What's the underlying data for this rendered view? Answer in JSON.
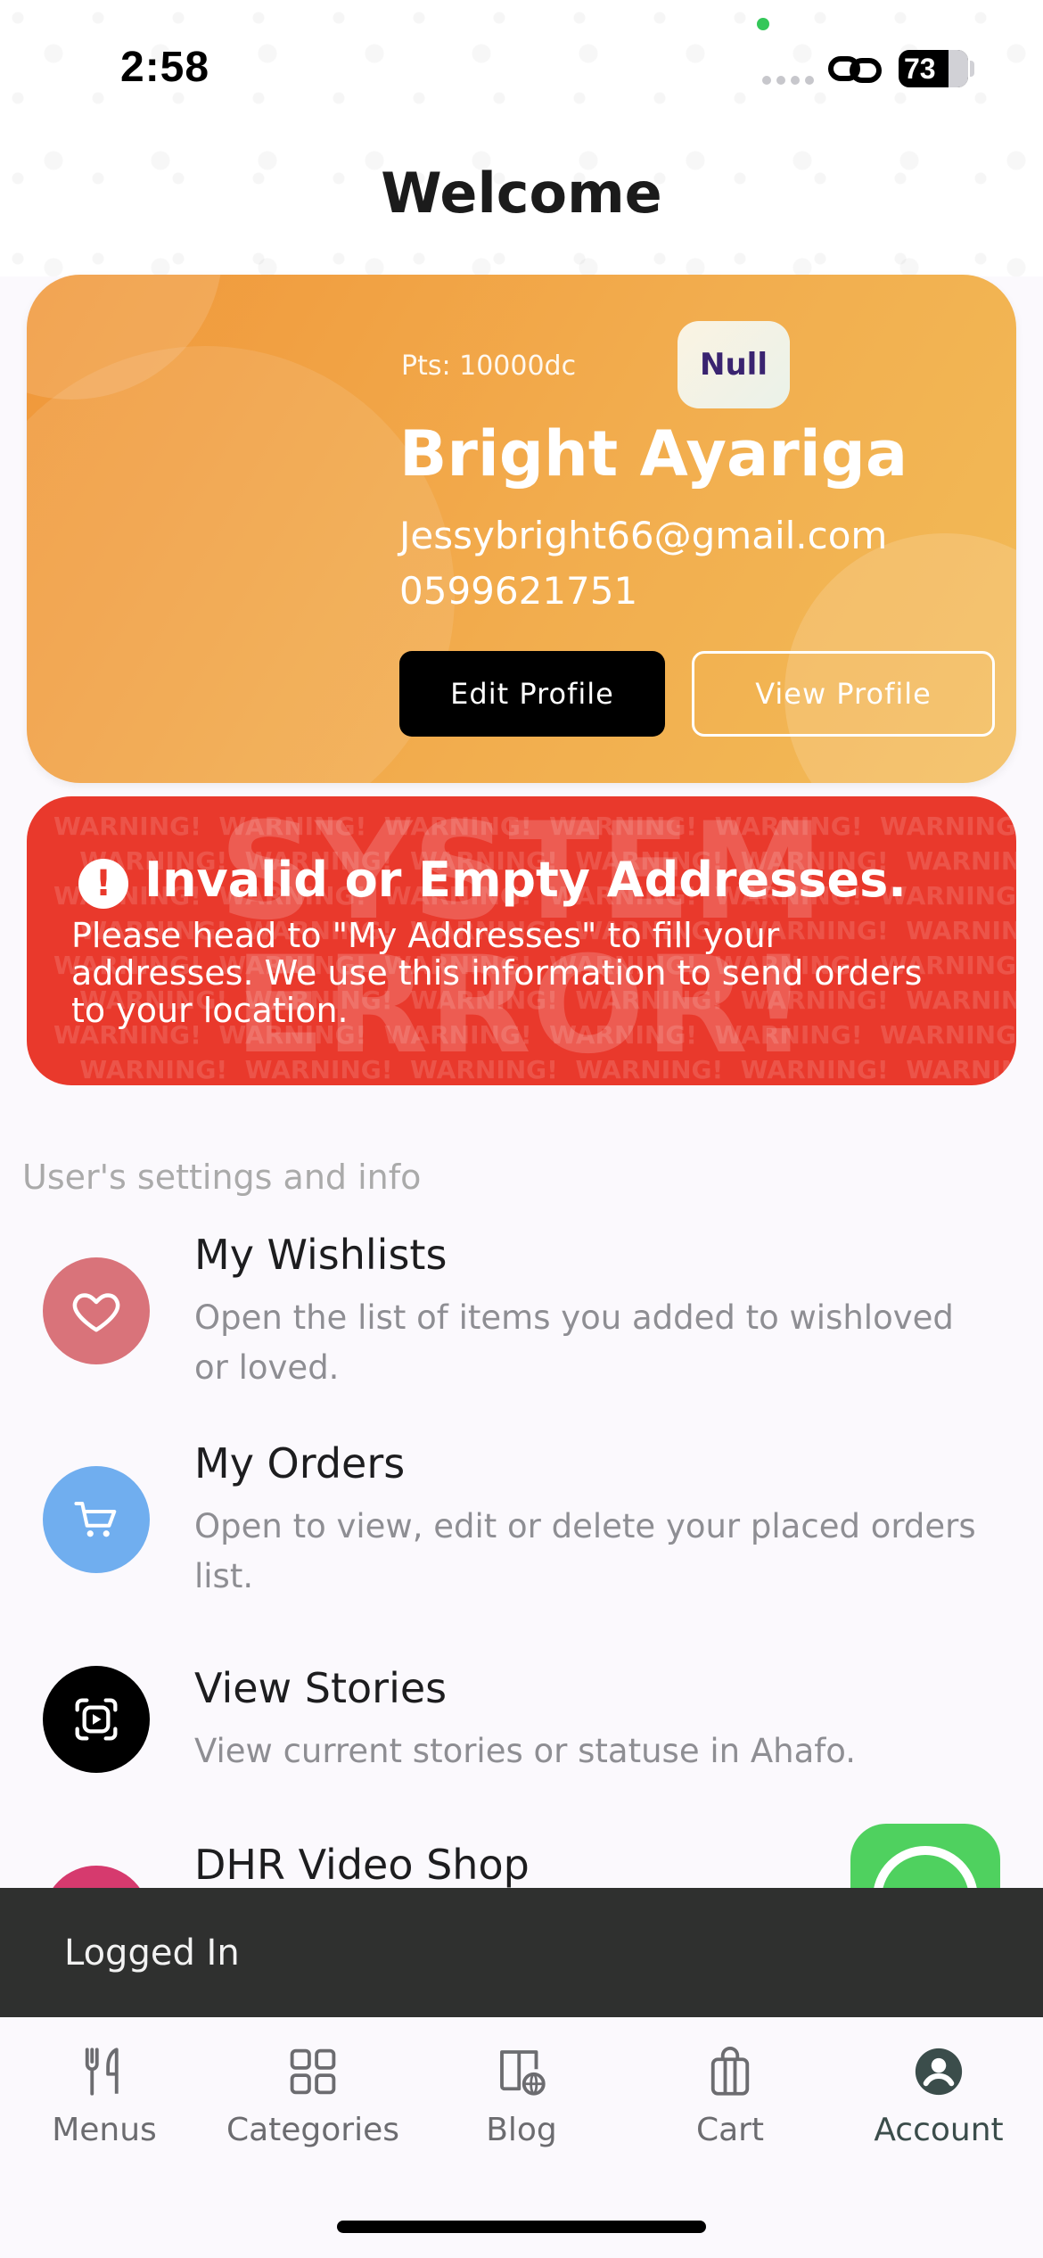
{
  "status_bar": {
    "time": "2:58",
    "battery": "73"
  },
  "header": {
    "title": "Welcome"
  },
  "profile": {
    "points": "Pts: 10000dc",
    "tier_badge": "Null",
    "name": "Bright Ayariga",
    "email": "Jessybright66@gmail.com",
    "phone": "0599621751",
    "edit_button": "Edit Profile",
    "view_button": "View Profile"
  },
  "warning": {
    "title": "Invalid or Empty Addresses.",
    "body": "Please head to \"My Addresses\" to fill your addresses. We use this information to send orders to your location.",
    "watermark": "SYSTEM ERROR!",
    "pattern_word": "WARNING!"
  },
  "settings": {
    "section_label": "User's settings and info",
    "items": [
      {
        "title": "My Wishlists",
        "description": "Open the list of items you added to wishloved or loved.",
        "icon": "heart-icon",
        "color": "#d9737a"
      },
      {
        "title": "My Orders",
        "description": "Open to view, edit or delete your placed orders list.",
        "icon": "cart-icon",
        "color": "#70aeef"
      },
      {
        "title": "View Stories",
        "description": "View current stories or statuse in Ahafo.",
        "icon": "stories-icon",
        "color": "#000000"
      },
      {
        "title": "DHR Video Shop",
        "description": "",
        "icon": "video-shop-icon",
        "color": "#d63a6e"
      }
    ]
  },
  "snackbar": {
    "text": "Logged In"
  },
  "bottom_nav": {
    "items": [
      {
        "label": "Menus",
        "icon": "fork-knife-icon"
      },
      {
        "label": "Categories",
        "icon": "grid-icon"
      },
      {
        "label": "Blog",
        "icon": "book-globe-icon"
      },
      {
        "label": "Cart",
        "icon": "bag-icon"
      },
      {
        "label": "Account",
        "icon": "account-icon",
        "active": true
      }
    ]
  },
  "colors": {
    "accent_orange": "#f2ad4e",
    "warning_red": "#e9392c",
    "snackbar": "#2f302f",
    "whatsapp_green": "#4fd15f"
  }
}
